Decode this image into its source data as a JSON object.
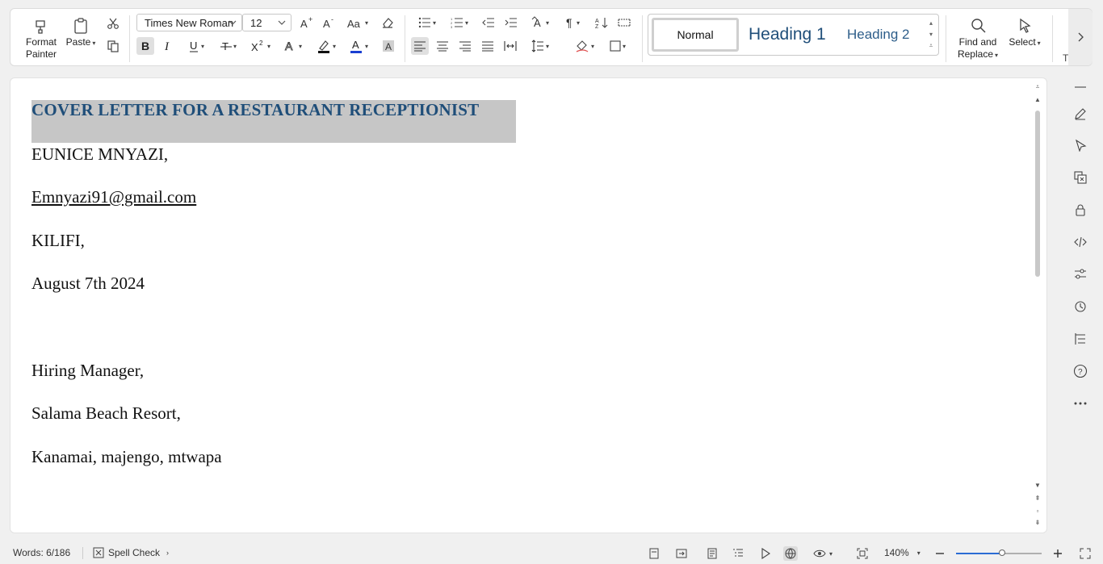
{
  "ribbon": {
    "format_painter": "Format Painter",
    "format_painter_line1": "Format",
    "format_painter_line2": "Painter",
    "paste": "Paste",
    "font_name": "Times New Roman",
    "font_size": "12",
    "styles": {
      "normal": "Normal",
      "heading1": "Heading 1",
      "heading2": "Heading 2"
    },
    "find_replace_line1": "Find and",
    "find_replace_line2": "Replace",
    "select": "Select",
    "overflow_letter": "T"
  },
  "document": {
    "title": "COVER LETTER FOR A RESTAURANT RECEPTIONIST",
    "paragraphs": [
      "EUNICE MNYAZI,",
      "Emnyazi91@gmail.com",
      "KILIFI,",
      "August 7th 2024",
      "Hiring Manager,",
      "Salama Beach Resort,",
      "Kanamai, majengo, mtwapa"
    ]
  },
  "status": {
    "words": "Words: 6/186",
    "spell_check": "Spell Check",
    "zoom": "140%",
    "zoom_level_fraction": 0.54
  },
  "colors": {
    "accent_blue": "#2b6cd4",
    "title_blue": "#1f4e79",
    "selection_gray": "#c6c6c6",
    "font_color_underline": "#1a3fd1"
  }
}
